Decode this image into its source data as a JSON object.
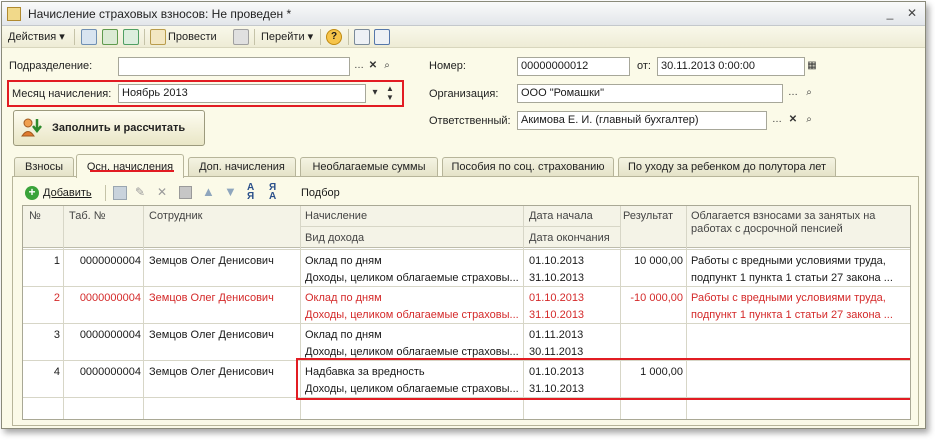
{
  "window": {
    "title": "Начисление страховых взносов: Не проведен *"
  },
  "toolbar": {
    "actions_label": "Действия",
    "post_label": "Провести",
    "goto_label": "Перейти"
  },
  "form": {
    "department_label": "Подразделение:",
    "department_value": "",
    "month_label": "Месяц начисления:",
    "month_value": "Ноябрь 2013",
    "fill_button": "Заполнить и рассчитать",
    "number_label": "Номер:",
    "number_value": "00000000012",
    "date_label": "от:",
    "date_value": "30.11.2013  0:00:00",
    "org_label": "Организация:",
    "org_value": "ООО \"Ромашки\"",
    "resp_label": "Ответственный:",
    "resp_value": "Акимова Е. И. (главный бухгалтер)"
  },
  "tabs": [
    {
      "label": "Взносы"
    },
    {
      "label": "Осн. начисления"
    },
    {
      "label": "Доп. начисления"
    },
    {
      "label": "Необлагаемые суммы"
    },
    {
      "label": "Пособия по соц. страхованию"
    },
    {
      "label": "По уходу за ребенком до полутора лет"
    }
  ],
  "table_toolbar": {
    "add_label": "Добавить",
    "select_label": "Подбор"
  },
  "table": {
    "headers": {
      "num": "№",
      "tab": "Таб. №",
      "employee": "Сотрудник",
      "accrual": "Начисление",
      "income_type": "Вид дохода",
      "date_start": "Дата начала",
      "date_end": "Дата окончания",
      "result": "Результат",
      "taxed_1": "Облагается взносами за занятых на",
      "taxed_2": "работах с досрочной пенсией"
    },
    "rows": [
      {
        "num": "1",
        "tab": "0000000004",
        "employee": "Земцов Олег Денисович",
        "accrual": "Оклад по дням",
        "income": "Доходы, целиком облагаемые страховы...",
        "start": "01.10.2013",
        "end": "31.10.2013",
        "result": "10 000,00",
        "taxed_1": "Работы с вредными условиями труда,",
        "taxed_2": "подпункт 1 пункта 1 статьи 27 закона ..."
      },
      {
        "num": "2",
        "tab": "0000000004",
        "employee": "Земцов Олег Денисович",
        "accrual": "Оклад по дням",
        "income": "Доходы, целиком облагаемые страховы...",
        "start": "01.10.2013",
        "end": "31.10.2013",
        "result": "-10 000,00",
        "taxed_1": "Работы с вредными условиями труда,",
        "taxed_2": "подпункт 1 пункта 1 статьи 27 закона ..."
      },
      {
        "num": "3",
        "tab": "0000000004",
        "employee": "Земцов Олег Денисович",
        "accrual": "Оклад по дням",
        "income": "Доходы, целиком облагаемые страховы...",
        "start": "01.11.2013",
        "end": "30.11.2013",
        "result": "",
        "taxed_1": "",
        "taxed_2": ""
      },
      {
        "num": "4",
        "tab": "0000000004",
        "employee": "Земцов Олег Денисович",
        "accrual": "Надбавка за вредность",
        "income": "Доходы, целиком облагаемые страховы...",
        "start": "01.10.2013",
        "end": "31.10.2013",
        "result": "1 000,00",
        "taxed_1": "",
        "taxed_2": ""
      }
    ]
  },
  "colors": {
    "highlight": "#e21c23",
    "storno_text": "#d42a2a"
  }
}
